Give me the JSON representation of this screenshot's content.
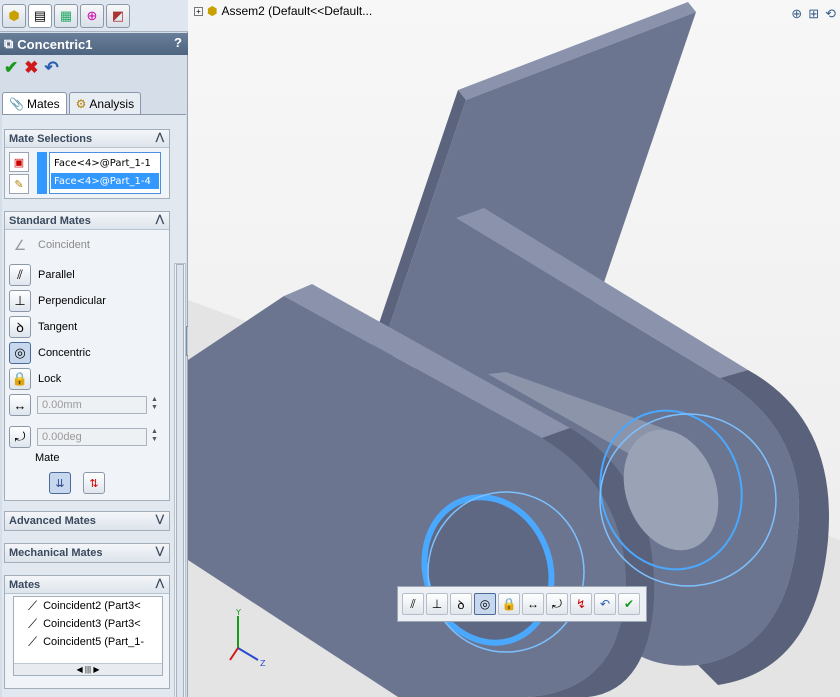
{
  "sidebar": {
    "icon_tabs": [
      "feature-manager-icon",
      "property-manager-icon",
      "configuration-manager-icon",
      "dim-xpert-icon",
      "display-manager-icon"
    ],
    "title": "Concentric1",
    "help": "?",
    "actions": {
      "ok": "✔",
      "cancel": "✖",
      "undo": "↶"
    },
    "tabs": [
      {
        "label": "Mates"
      },
      {
        "label": "Analysis"
      }
    ],
    "mate_selections": {
      "header": "Mate Selections",
      "items": [
        "Face<4>@Part_1-1",
        "Face<4>@Part_1-4"
      ]
    },
    "standard_mates": {
      "header": "Standard Mates",
      "items": [
        {
          "label": "Coincident",
          "icon": "coincident-icon"
        },
        {
          "label": "Parallel",
          "icon": "parallel-icon"
        },
        {
          "label": "Perpendicular",
          "icon": "perpendicular-icon"
        },
        {
          "label": "Tangent",
          "icon": "tangent-icon"
        },
        {
          "label": "Concentric",
          "icon": "concentric-icon"
        },
        {
          "label": "Lock",
          "icon": "lock-icon"
        }
      ],
      "distance_value": "0.00mm",
      "angle_value": "0.00deg",
      "alignment_label": "Mate"
    },
    "advanced_mates": {
      "header": "Advanced Mates"
    },
    "mechanical_mates": {
      "header": "Mechanical Mates"
    },
    "mates": {
      "header": "Mates",
      "items": [
        "Coincident2 (Part3<",
        "Coincident3 (Part3<",
        "Coincident5 (Part_1-"
      ]
    }
  },
  "viewport": {
    "tree_title": "Assem2  (Default<<Default...",
    "top_icons": [
      "zoom-to-fit-icon",
      "zoom-area-icon",
      "previous-view-icon"
    ]
  },
  "colors": {
    "part_face": "#6b7590",
    "part_top": "#8a93ab",
    "selection_blue": "#4aa8ff",
    "sidebar_bg": "#d4dde8"
  }
}
